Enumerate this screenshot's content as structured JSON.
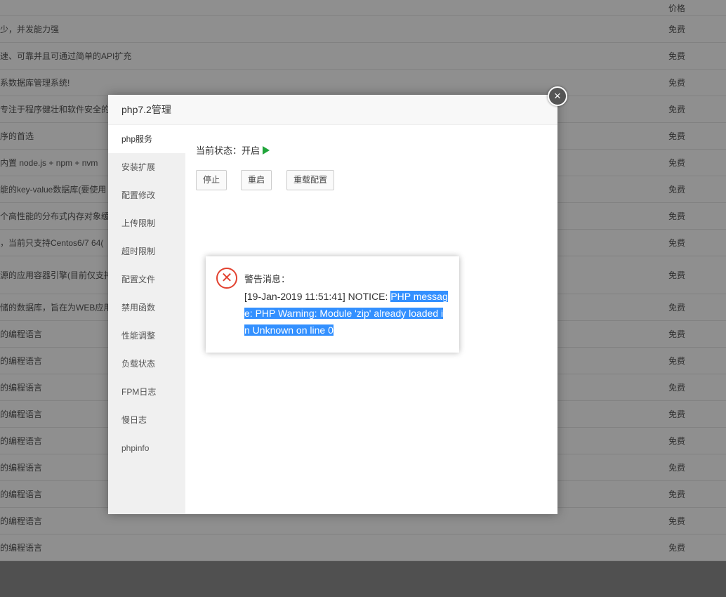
{
  "background_table": {
    "price_header": "价格",
    "rows": [
      {
        "desc": "少，并发能力强",
        "price": "免费"
      },
      {
        "desc": "速、可靠并且可通过简单的API扩充",
        "price": "免费"
      },
      {
        "desc": "系数据库管理系统!",
        "price": "免费"
      },
      {
        "desc": "专注于程序健壮和软件安全的",
        "price": "免费"
      },
      {
        "desc": "序的首选",
        "price": "免费"
      },
      {
        "desc": "内置 node.js + npm + nvm",
        "price": "免费"
      },
      {
        "desc": "能的key-value数据库(要使用",
        "price": "免费"
      },
      {
        "desc": "个高性能的分布式内存对象缓",
        "price": "免费"
      },
      {
        "desc": "，当前只支持Centos6/7 64(",
        "price": "免费"
      },
      {
        "desc": "源的应用容器引擎(目前仅支持",
        "price": "免费"
      },
      {
        "desc": "储的数据库，旨在为WEB应用",
        "price": "免费"
      },
      {
        "desc": "的编程语言",
        "price": "免费"
      },
      {
        "desc": "的编程语言",
        "price": "免费"
      },
      {
        "desc": "的编程语言",
        "price": "免费"
      },
      {
        "desc": "的编程语言",
        "price": "免费"
      },
      {
        "desc": "的编程语言",
        "price": "免费"
      },
      {
        "desc": "的编程语言",
        "price": "免费"
      },
      {
        "desc": "的编程语言",
        "price": "免费"
      },
      {
        "desc": "的编程语言",
        "price": "免费"
      },
      {
        "desc": "的编程语言",
        "price": "免费"
      }
    ]
  },
  "dialog": {
    "title": "php7.2管理",
    "close_icon": "close-icon",
    "sidebar": [
      {
        "label": "php服务",
        "active": true
      },
      {
        "label": "安装扩展"
      },
      {
        "label": "配置修改"
      },
      {
        "label": "上传限制"
      },
      {
        "label": "超时限制"
      },
      {
        "label": "配置文件"
      },
      {
        "label": "禁用函数"
      },
      {
        "label": "性能调整"
      },
      {
        "label": "负载状态"
      },
      {
        "label": "FPM日志"
      },
      {
        "label": "慢日志"
      },
      {
        "label": "phpinfo"
      }
    ],
    "status_label": "当前状态：",
    "status_value": "开启",
    "status_color": "#20a53a",
    "buttons": {
      "stop": "停止",
      "restart": "重启",
      "reload": "重载配置"
    }
  },
  "alert": {
    "icon": "error-x-icon",
    "icon_color": "#e2412f",
    "title": "警告消息：",
    "message_prefix": "[19-Jan-2019 11:51:41] NOTICE: ",
    "message_selected": "PHP message: PHP Warning: Module 'zip' already loaded in Unknown on line 0",
    "selection_color": "#3390ff"
  }
}
